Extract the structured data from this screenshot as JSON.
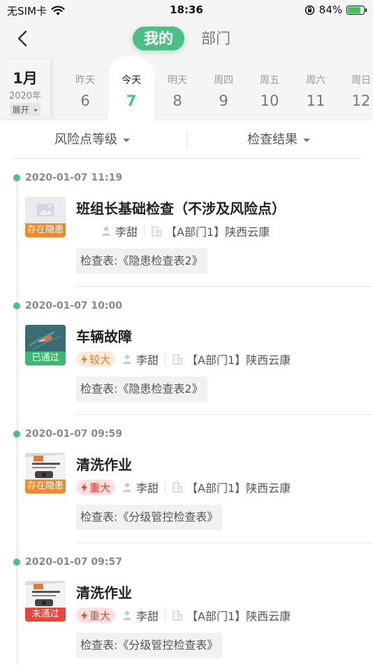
{
  "status_bar": {
    "carrier": "无SIM卡",
    "time": "18:36",
    "battery": "84%",
    "battery_level": 0.84
  },
  "nav": {
    "tab_mine": "我的",
    "tab_dept": "部门"
  },
  "calendar": {
    "month": "1月",
    "year": "2020年",
    "expand": "展开",
    "days": [
      {
        "name": "昨天",
        "date": "6"
      },
      {
        "name": "今天",
        "date": "7"
      },
      {
        "name": "明天",
        "date": "8"
      },
      {
        "name": "周四",
        "date": "9"
      },
      {
        "name": "周五",
        "date": "10"
      },
      {
        "name": "周六",
        "date": "11"
      },
      {
        "name": "周日",
        "date": "12"
      }
    ]
  },
  "filters": {
    "risk_level": "风险点等级",
    "result": "检查结果"
  },
  "entries": [
    {
      "time": "2020-01-07 11:19",
      "title": "班组长基础检查（不涉及风险点）",
      "status": "存在隐患",
      "level": "",
      "person": "李甜",
      "dept": "【A部门1】陕西云康",
      "table": "检查表:《隐患检查表2》"
    },
    {
      "time": "2020-01-07 10:00",
      "title": "车辆故障",
      "status": "已通过",
      "level": "较大",
      "person": "李甜",
      "dept": "【A部门1】陕西云康",
      "table": "检查表:《隐患检查表2》"
    },
    {
      "time": "2020-01-07 09:59",
      "title": "清洗作业",
      "status": "存在隐患",
      "level": "重大",
      "person": "李甜",
      "dept": "【A部门1】陕西云康",
      "table": "检查表:《分级管控检查表》"
    },
    {
      "time": "2020-01-07 09:57",
      "title": "清洗作业",
      "status": "未通过",
      "level": "重大",
      "person": "李甜",
      "dept": "【A部门1】陕西云康",
      "table": "检查表:《分级管控检查表》"
    }
  ],
  "colors": {
    "accent": "#4cbf82",
    "status_orange": "#ef8a2c",
    "status_green": "#3db871",
    "status_red": "#e8453c"
  }
}
